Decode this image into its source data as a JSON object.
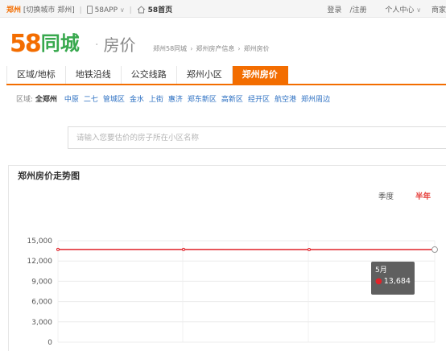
{
  "topbar": {
    "city": "郑州",
    "switch_city": "[切换城市 郑州]",
    "app": "58APP",
    "home": "58首页",
    "login": "登录",
    "register": "/注册",
    "user_center": "个人中心",
    "merchant": "商家"
  },
  "header": {
    "logo_58": "58",
    "logo_text": "同城",
    "section_title": "房价",
    "breadcrumb": [
      "郑州58同城",
      "郑州房产信息",
      "郑州房价"
    ]
  },
  "nav": {
    "tabs": [
      {
        "label": "区域/地标",
        "active": false
      },
      {
        "label": "地铁沿线",
        "active": false
      },
      {
        "label": "公交线路",
        "active": false
      },
      {
        "label": "郑州小区",
        "active": false
      },
      {
        "label": "郑州房价",
        "active": true
      }
    ]
  },
  "districts": {
    "label": "区域:",
    "current": "全郑州",
    "items": [
      "中原",
      "二七",
      "管城区",
      "金水",
      "上街",
      "惠济",
      "郑东新区",
      "高新区",
      "经开区",
      "航空港",
      "郑州周边"
    ]
  },
  "search": {
    "placeholder": "请输入您要估价的房子所在小区名称",
    "value": ""
  },
  "chart_panel": {
    "title": "郑州房价走势图",
    "range_season": "季度",
    "range_half_year": "半年"
  },
  "chart_data": {
    "type": "line",
    "title": "郑州房价走势图",
    "xlabel": "",
    "ylabel": "",
    "ylim": [
      0,
      15000
    ],
    "yticks": [
      0,
      3000,
      6000,
      9000,
      12000,
      15000
    ],
    "ytick_labels": [
      "0",
      "3,000",
      "6,000",
      "9,000",
      "12,000",
      "15,000"
    ],
    "series": [
      {
        "values": [
          13700,
          13700,
          13690,
          13684
        ],
        "color": "#e0232a"
      }
    ],
    "grid": true,
    "tooltip": {
      "label": "5月",
      "value": "13,684"
    }
  }
}
